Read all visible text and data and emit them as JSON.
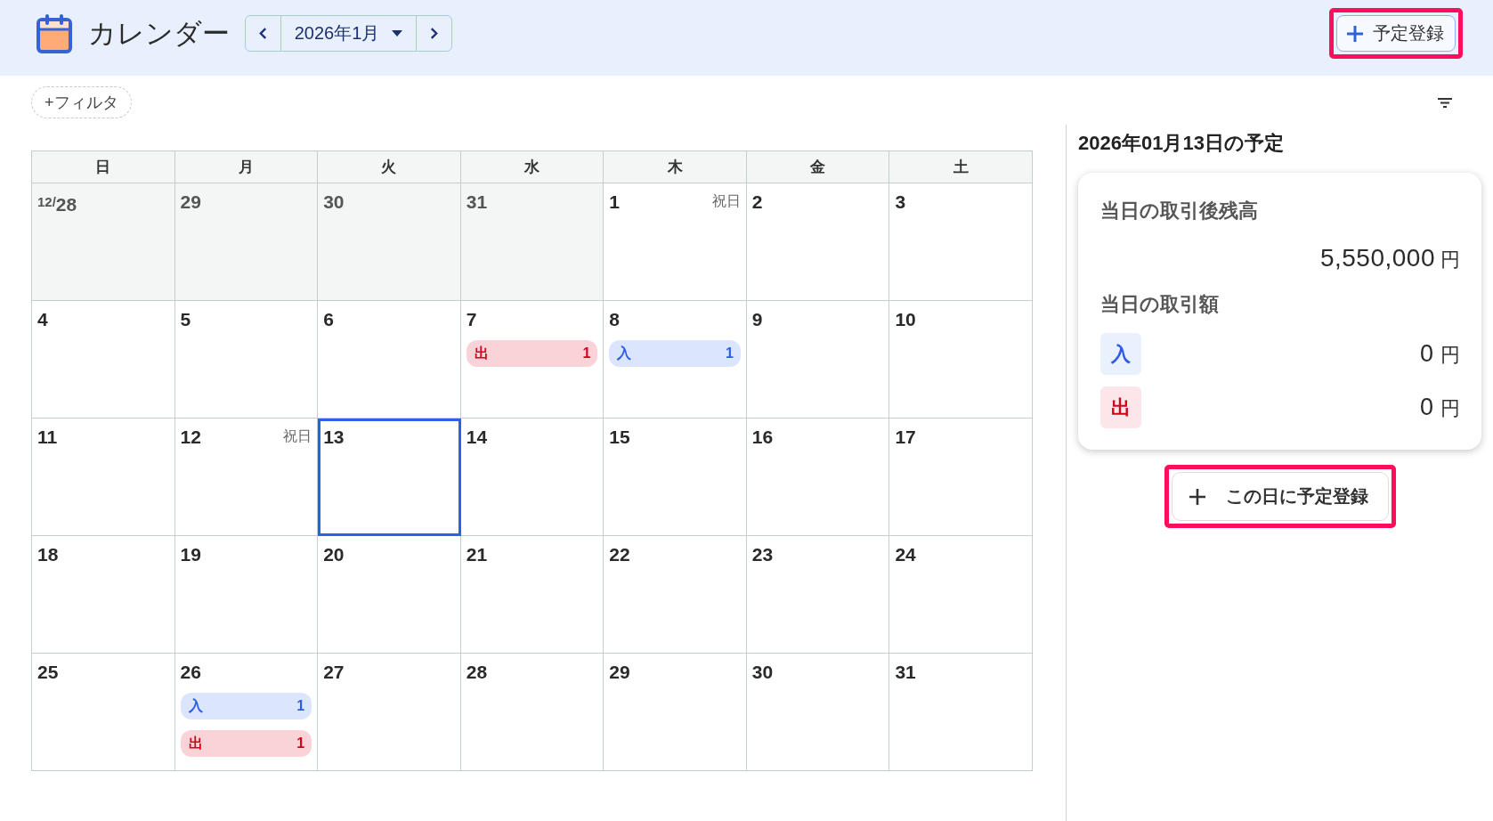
{
  "header": {
    "title": "カレンダー",
    "month": "2026年1月",
    "register_button": {
      "label": "予定登録",
      "highlighted": true
    }
  },
  "toolbar": {
    "filter_chip": "+フィルタ"
  },
  "calendar": {
    "weekdays": [
      "日",
      "月",
      "火",
      "水",
      "木",
      "金",
      "土"
    ],
    "weeks": [
      [
        {
          "prefix": "12/",
          "day": "28",
          "other_month": true,
          "selected": false
        },
        {
          "day": "29",
          "other_month": true,
          "selected": false
        },
        {
          "day": "30",
          "other_month": true,
          "selected": false
        },
        {
          "day": "31",
          "other_month": true,
          "selected": false
        },
        {
          "day": "1",
          "holiday": "祝日",
          "other_month": false,
          "selected": false
        },
        {
          "day": "2",
          "other_month": false,
          "selected": false
        },
        {
          "day": "3",
          "other_month": false,
          "selected": false
        }
      ],
      [
        {
          "day": "4",
          "other_month": false,
          "selected": false
        },
        {
          "day": "5",
          "other_month": false,
          "selected": false
        },
        {
          "day": "6",
          "other_month": false,
          "selected": false
        },
        {
          "day": "7",
          "other_month": false,
          "selected": false,
          "events": [
            {
              "kind": "out",
              "label": "出",
              "count": "1"
            }
          ]
        },
        {
          "day": "8",
          "other_month": false,
          "selected": false,
          "events": [
            {
              "kind": "in",
              "label": "入",
              "count": "1"
            }
          ]
        },
        {
          "day": "9",
          "other_month": false,
          "selected": false
        },
        {
          "day": "10",
          "other_month": false,
          "selected": false
        }
      ],
      [
        {
          "day": "11",
          "other_month": false,
          "selected": false
        },
        {
          "day": "12",
          "holiday": "祝日",
          "other_month": false,
          "selected": false
        },
        {
          "day": "13",
          "other_month": false,
          "selected": true
        },
        {
          "day": "14",
          "other_month": false,
          "selected": false
        },
        {
          "day": "15",
          "other_month": false,
          "selected": false
        },
        {
          "day": "16",
          "other_month": false,
          "selected": false
        },
        {
          "day": "17",
          "other_month": false,
          "selected": false
        }
      ],
      [
        {
          "day": "18",
          "other_month": false,
          "selected": false
        },
        {
          "day": "19",
          "other_month": false,
          "selected": false
        },
        {
          "day": "20",
          "other_month": false,
          "selected": false
        },
        {
          "day": "21",
          "other_month": false,
          "selected": false
        },
        {
          "day": "22",
          "other_month": false,
          "selected": false
        },
        {
          "day": "23",
          "other_month": false,
          "selected": false
        },
        {
          "day": "24",
          "other_month": false,
          "selected": false
        }
      ],
      [
        {
          "day": "25",
          "other_month": false,
          "selected": false
        },
        {
          "day": "26",
          "other_month": false,
          "selected": false,
          "events": [
            {
              "kind": "in",
              "label": "入",
              "count": "1"
            },
            {
              "kind": "out",
              "label": "出",
              "count": "1"
            }
          ]
        },
        {
          "day": "27",
          "other_month": false,
          "selected": false
        },
        {
          "day": "28",
          "other_month": false,
          "selected": false
        },
        {
          "day": "29",
          "other_month": false,
          "selected": false
        },
        {
          "day": "30",
          "other_month": false,
          "selected": false
        },
        {
          "day": "31",
          "other_month": false,
          "selected": false
        }
      ]
    ]
  },
  "detail": {
    "title": "2026年01月13日の予定",
    "balance_label": "当日の取引後残高",
    "balance": "5,550,000",
    "balance_unit": "円",
    "amount_label": "当日の取引額",
    "amounts": [
      {
        "kind": "in",
        "label": "入",
        "value": "0",
        "unit": "円"
      },
      {
        "kind": "out",
        "label": "出",
        "value": "0",
        "unit": "円"
      }
    ],
    "add_button": {
      "label": "この日に予定登録",
      "highlighted": true
    }
  }
}
